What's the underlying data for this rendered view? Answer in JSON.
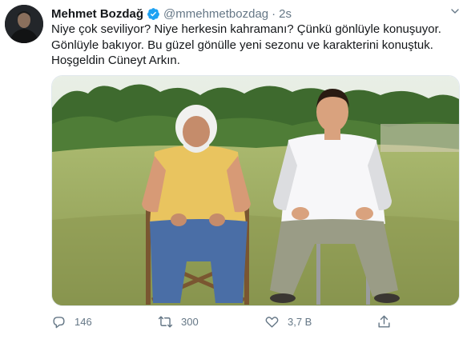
{
  "tweet": {
    "author_name": "Mehmet Bozdağ",
    "author_handle": "@mmehmetbozdag",
    "separator": "·",
    "time": "2s",
    "text_lines": [
      "Niye çok seviliyor? Niye herkesin kahramanı? Çünkü gönlüyle konuşuyor.",
      "Gönlüyle bakıyor. Bu güzel gönülle yeni sezonu ve karakterini konuştuk.",
      "Hoşgeldin Cüneyt Arkın."
    ]
  },
  "actions": {
    "reply_count": "146",
    "retweet_count": "300",
    "like_count": "3,7 B"
  },
  "icons": {
    "verified": "verified-badge-icon",
    "more": "chevron-down-icon",
    "reply": "reply-icon",
    "retweet": "retweet-icon",
    "like": "heart-icon",
    "share": "share-icon"
  },
  "colors": {
    "verified": "#1da1f2",
    "secondary_text": "#657786",
    "primary_text": "#14171a"
  }
}
